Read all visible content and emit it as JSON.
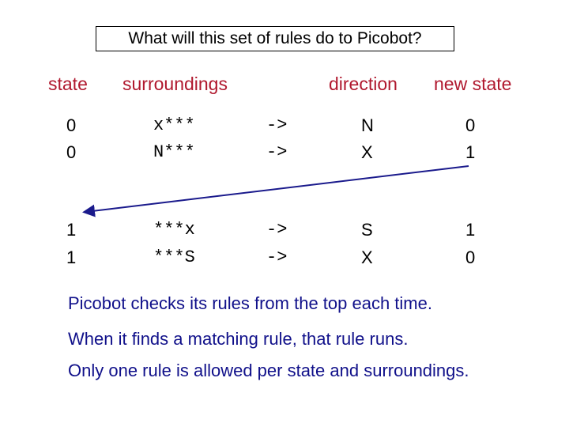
{
  "title": "What will this set of rules do to Picobot?",
  "headers": {
    "state": "state",
    "surroundings": "surroundings",
    "direction": "direction",
    "new_state": "new state"
  },
  "rules": [
    {
      "state": "0",
      "surroundings": "x***",
      "arrow": "->",
      "direction": "N",
      "new_state": "0"
    },
    {
      "state": "0",
      "surroundings": "N***",
      "arrow": "->",
      "direction": "X",
      "new_state": "1"
    },
    {
      "state": "1",
      "surroundings": "***x",
      "arrow": "->",
      "direction": "S",
      "new_state": "1"
    },
    {
      "state": "1",
      "surroundings": "***S",
      "arrow": "->",
      "direction": "X",
      "new_state": "0"
    }
  ],
  "annotation": {
    "type": "arrow",
    "from": "rule 2 new state",
    "to": "state 1 rules",
    "color": "#1a1a8c"
  },
  "notes": [
    "Picobot checks its rules from the top each time.",
    "When it finds a matching rule, that rule runs.",
    "Only one rule is allowed per state and surroundings."
  ],
  "colors": {
    "header": "#b0182e",
    "notes": "#10108a",
    "arrow": "#1a1a8c"
  }
}
